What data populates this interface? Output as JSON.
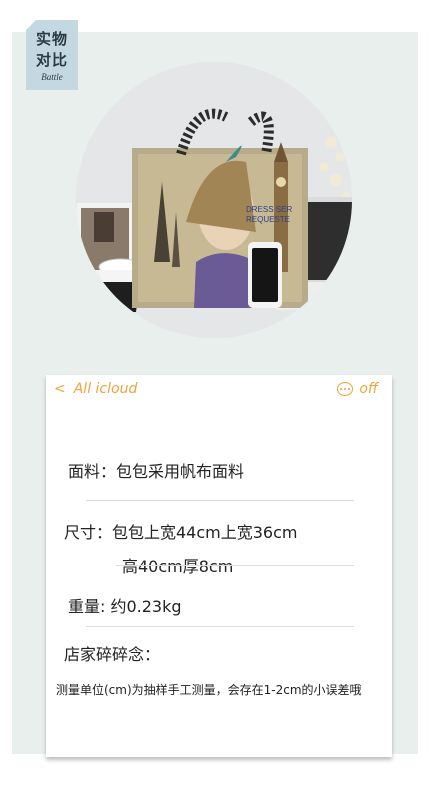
{
  "badge": {
    "line1": "实物",
    "line2": "对比",
    "sub": "Battle"
  },
  "card": {
    "back_label": "All icloud",
    "toggle_label": "off",
    "fabric": "面料：包包采用帆布面料",
    "size_line1": "尺寸：包包上宽44cm上宽36cm",
    "size_line2": "高40cm厚8cm",
    "weight": "重量: 约0.23kg",
    "shop_title": "店家碎碎念：",
    "shop_note": "测量单位(cm)为抽样手工测量，会存在1-2cm的小误差哦"
  },
  "colors": {
    "accent": "#f1a23a",
    "panel": "#e9efec",
    "badge": "#c3d8e0"
  }
}
